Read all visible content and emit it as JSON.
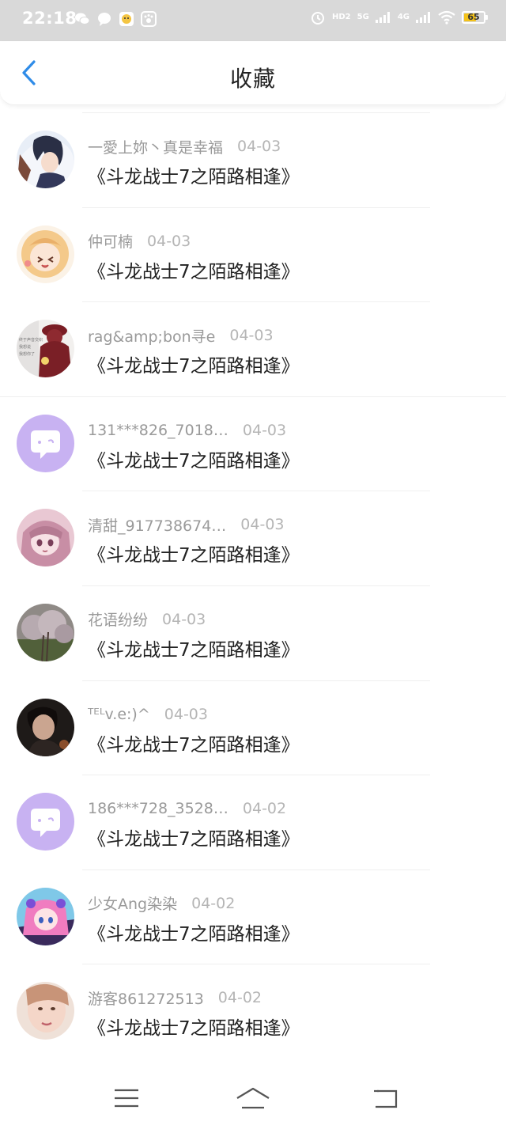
{
  "status_bar": {
    "time": "22:18",
    "network_tags": [
      "HD2",
      "5G",
      "4G"
    ],
    "battery_level": "65"
  },
  "header": {
    "title": "收藏"
  },
  "favorites": [
    {
      "name": "一愛上妳丶真是幸福",
      "date": "04-03",
      "title": "《斗龙战士7之陌路相逢》",
      "avatar": "anime-boy"
    },
    {
      "name": "仲可楠",
      "date": "04-03",
      "title": "《斗龙战士7之陌路相逢》",
      "avatar": "anime-girl-blonde"
    },
    {
      "name": "rag&amp;bon寻e",
      "date": "04-03",
      "title": "《斗龙战士7之陌路相逢》",
      "avatar": "girl-red-hat"
    },
    {
      "name": "131***826_7018…",
      "date": "04-03",
      "title": "《斗龙战士7之陌路相逢》",
      "avatar": "default-chat"
    },
    {
      "name": "清甜_917738674…",
      "date": "04-03",
      "title": "《斗龙战士7之陌路相逢》",
      "avatar": "anime-girl-pink"
    },
    {
      "name": "花语纷纷",
      "date": "04-03",
      "title": "《斗龙战士7之陌路相逢》",
      "avatar": "blossom-tree"
    },
    {
      "name": "ᵀᴱᴸv.e:)^",
      "date": "04-03",
      "title": "《斗龙战士7之陌路相逢》",
      "avatar": "man-dark"
    },
    {
      "name": "186***728_3528…",
      "date": "04-02",
      "title": "《斗龙战士7之陌路相逢》",
      "avatar": "default-chat"
    },
    {
      "name": "少女Ang染染",
      "date": "04-02",
      "title": "《斗龙战士7之陌路相逢》",
      "avatar": "anime-girl-colorful"
    },
    {
      "name": "游客861272513",
      "date": "04-02",
      "title": "《斗龙战士7之陌路相逢》",
      "avatar": "woman-photo"
    }
  ],
  "colors": {
    "accent": "#2f8ce8",
    "default_avatar_bg": "#c8b2f2",
    "status_bar_bg": "#d9d9d9",
    "battery": "#f3c21b"
  },
  "icons": {
    "back": "chevron-left-icon",
    "menu": "menu-icon",
    "home": "home-icon",
    "return": "return-icon"
  }
}
